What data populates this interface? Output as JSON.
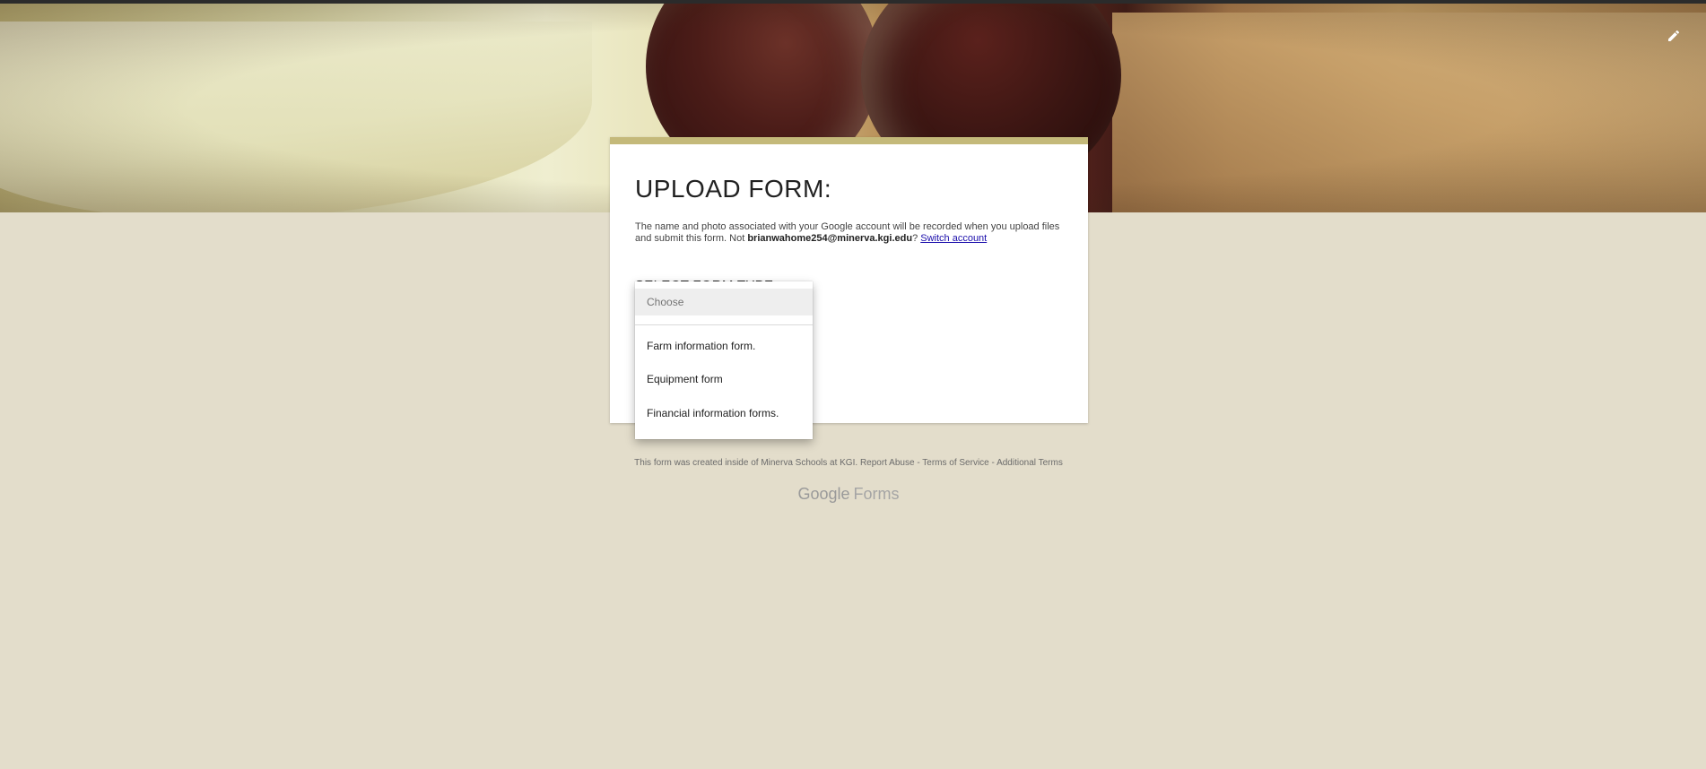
{
  "header": {
    "edit_icon": "pencil-icon"
  },
  "form": {
    "title": "UPLOAD FORM:",
    "notice_prefix": "The name and photo associated with your Google account will be recorded when you upload files and submit this form. Not ",
    "account_email": "brianwahome254@minerva.kgi.edu",
    "notice_suffix": "? ",
    "switch_account": "Switch account",
    "question_label": "SELECT FORM TYPE"
  },
  "dropdown": {
    "placeholder": "Choose",
    "options": [
      "Farm information form.",
      "Equipment form",
      "Financial information forms."
    ]
  },
  "footer": {
    "created_text": "This form was created inside of Minerva Schools at KGI.",
    "report_abuse": "Report Abuse",
    "sep": " - ",
    "terms": "Terms of Service",
    "additional_terms": "Additional Terms"
  },
  "brand": {
    "google": "Google",
    "forms": "Forms"
  },
  "colors": {
    "background": "#e3ddcb",
    "accent": "#c4b97a"
  }
}
